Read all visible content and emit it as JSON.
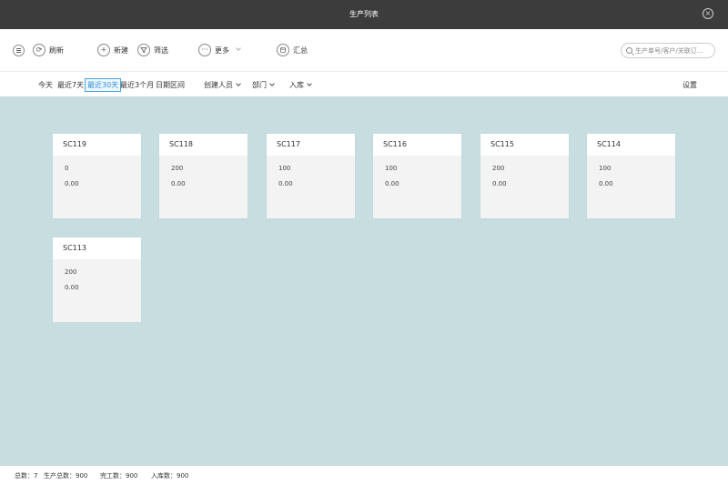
{
  "window": {
    "title": "生产列表"
  },
  "toolbar": {
    "refresh_label": "刷新",
    "new_label": "新建",
    "filter_label": "筛选",
    "more_label": "更多",
    "summary_label": "汇总",
    "search_placeholder": "生产单号/客户/关联订..."
  },
  "filters": {
    "today": "今天",
    "last7": "最近7天",
    "last30": "最近30天",
    "last3m": "最近3个月",
    "date_range": "日期区间",
    "creator": "创建人员",
    "dept": "部门",
    "storage": "入库",
    "settings": "设置",
    "active": "last30"
  },
  "cards": [
    {
      "code": "SC119",
      "qty": "0",
      "amount": "0.00"
    },
    {
      "code": "SC118",
      "qty": "200",
      "amount": "0.00"
    },
    {
      "code": "SC117",
      "qty": "100",
      "amount": "0.00"
    },
    {
      "code": "SC116",
      "qty": "100",
      "amount": "0.00"
    },
    {
      "code": "SC115",
      "qty": "200",
      "amount": "0.00"
    },
    {
      "code": "SC114",
      "qty": "100",
      "amount": "0.00"
    },
    {
      "code": "SC113",
      "qty": "200",
      "amount": "0.00"
    }
  ],
  "status": {
    "total": "总数：7",
    "production_total": "生产总数：900",
    "completed": "完工数：900",
    "stored": "入库数：900"
  },
  "colors": {
    "titlebar": "#3c3c3c",
    "content_bg": "#c8dde0",
    "accent": "#2a8fd5"
  }
}
